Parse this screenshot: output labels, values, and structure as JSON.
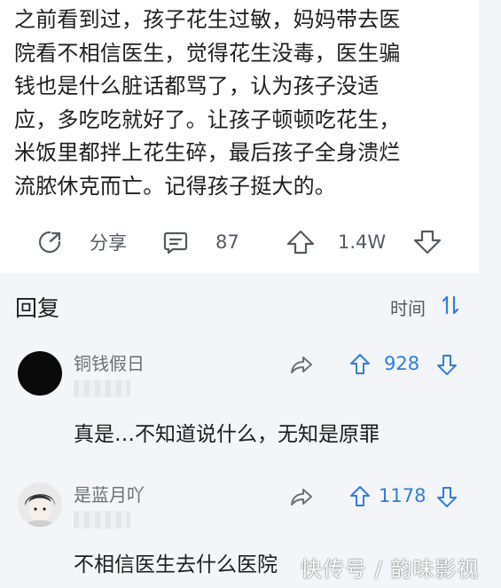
{
  "post": {
    "lines": [
      "之前看到过，孩子花生过敏，妈妈带去医",
      "院看不相信医生，觉得花生没毒，医生骗",
      "钱也是什么脏话都骂了，认为孩子没适",
      "应，多吃吃就好了。让孩子顿顿吃花生，",
      "米饭里都拌上花生碎，最后孩子全身溃烂",
      "流脓休克而亡。记得孩子挺大的。"
    ],
    "actions": {
      "share_label": "分享",
      "comment_count": "87",
      "upvote_count": "1.4W"
    }
  },
  "replies": {
    "title": "回复",
    "sort_label": "时间"
  },
  "comments": [
    {
      "name": "铜钱假日",
      "upvotes": "928",
      "text": "真是…不知道说什么，无知是原罪"
    },
    {
      "name": "是蓝月吖",
      "upvotes": "1178",
      "text": "不相信医生去什么医院"
    }
  ],
  "watermark": "快传号 / 韵味影视",
  "colors": {
    "accent": "#2e7fe0",
    "muted": "#555a60",
    "background": "#f3f5f9"
  },
  "icons": [
    "share-icon",
    "comment-icon",
    "upvote-icon",
    "downvote-icon",
    "sort-icon",
    "forward-icon"
  ]
}
